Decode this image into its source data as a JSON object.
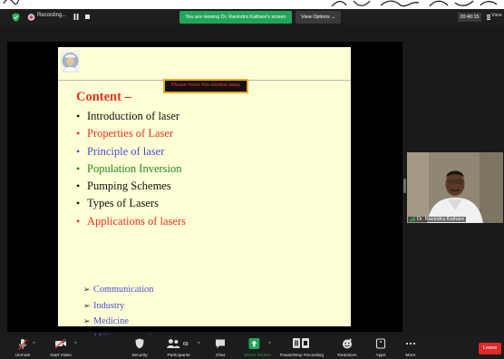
{
  "topbar": {
    "recording_label": "Recording...",
    "viewing_banner": "You are viewing Dr. Ravindra Kathare's screen",
    "view_options_label": "View Options",
    "view_options_caret": "⌄",
    "clock": "20:40:15",
    "view_label": "View"
  },
  "slide": {
    "move_notice": "Please move this window away",
    "heading": "Content –",
    "bullet_glyph": "•",
    "items": [
      {
        "text": "Introduction of laser",
        "color": "#111111"
      },
      {
        "text": "Properties  of Laser",
        "color": "#e8321f"
      },
      {
        "text": "Principle of laser",
        "color": "#4a4ad8"
      },
      {
        "text": "Population Inversion",
        "color": "#1f8a1f"
      },
      {
        "text": "Pumping Schemes",
        "color": "#111111"
      },
      {
        "text": "Types of Lasers",
        "color": "#111111"
      },
      {
        "text": "Applications of lasers",
        "color": "#e8321f"
      }
    ],
    "arrow_glyph": "➢",
    "sub_items": [
      "Communication",
      "Industry",
      "Medicine",
      "Military operation"
    ]
  },
  "video": {
    "participant_name": "Dr. Ravindra Kathare"
  },
  "toolbar": {
    "caret": "^",
    "unmute": "Unmute",
    "start_video": "Start Video",
    "security": "Security",
    "participants": "Participants",
    "participant_count": "69",
    "chat": "Chat",
    "share_screen": "Share Screen",
    "pause_recording": "Pause/Stop Recording",
    "reactions": "Reactions",
    "apps": "Apps",
    "more": "More",
    "leave": "Leave"
  },
  "colors": {
    "accent_green": "#23a559",
    "leave_red": "#e02828",
    "notice_border": "#f5a623"
  }
}
